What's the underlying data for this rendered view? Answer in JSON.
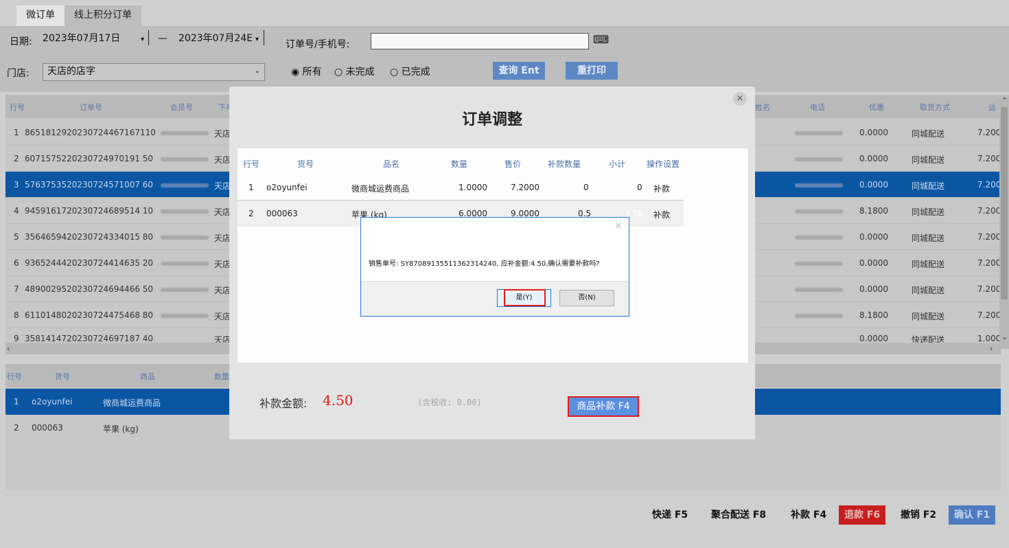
{
  "tabs": [
    "微订单",
    "线上积分订单"
  ],
  "filters": {
    "date_label": "日期:",
    "date_from": "2023年07月17日",
    "date_sep": "—",
    "date_to": "2023年07月24E",
    "order_label": "订单号/手机号:",
    "order_value": "",
    "store_label": "门店:",
    "store_value": "天店的店字",
    "radio_all": "◉ 所有",
    "radio_incomplete": "○ 未完成",
    "radio_complete": "○ 已完成",
    "query_button": "查询 Ent",
    "reprint_button": "重打印"
  },
  "orders_table": {
    "headers": [
      "行号",
      "订单号",
      "会员号",
      "下单",
      "姓名",
      "电话",
      "优惠",
      "取货方式",
      "运"
    ],
    "rows": [
      {
        "no": "1",
        "order": "8651812920230724467167110",
        "store": "天店",
        "discount": "0.0000",
        "delivery": "同城配送",
        "fee": "7.200"
      },
      {
        "no": "2",
        "order": "6071575220230724970191 50",
        "store": "天店",
        "discount": "0.0000",
        "delivery": "同城配送",
        "fee": "7.200"
      },
      {
        "no": "3",
        "order": "5763753520230724571007 60",
        "store": "天店",
        "discount": "0.0000",
        "delivery": "同城配送",
        "fee": "7.200"
      },
      {
        "no": "4",
        "order": "9459161720230724689514 10",
        "store": "天店",
        "discount": "8.1800",
        "delivery": "同城配送",
        "fee": "7.200"
      },
      {
        "no": "5",
        "order": "3564659420230724334015 80",
        "store": "天店",
        "discount": "0.0000",
        "delivery": "同城配送",
        "fee": "7.200"
      },
      {
        "no": "6",
        "order": "9365244420230724414635 20",
        "store": "天店",
        "discount": "0.0000",
        "delivery": "同城配送",
        "fee": "7.200"
      },
      {
        "no": "7",
        "order": "4890029520230724694466 50",
        "store": "天店",
        "discount": "0.0000",
        "delivery": "同城配送",
        "fee": "7.200"
      },
      {
        "no": "8",
        "order": "6110148020230724475468 80",
        "store": "天店",
        "discount": "8.1800",
        "delivery": "同城配送",
        "fee": "7.200"
      },
      {
        "no": "9",
        "order": "3581414720230724697187 40",
        "store": "天店",
        "discount": "0.0000",
        "delivery": "快递配送",
        "fee": "1.000"
      }
    ]
  },
  "items_table": {
    "headers": [
      "行号",
      "货号",
      "商品",
      "数量"
    ],
    "rows": [
      {
        "no": "1",
        "sku": "o2oyunfei",
        "name": "微商城运费商品"
      },
      {
        "no": "2",
        "sku": "000063",
        "name": "苹果 (kg)"
      }
    ]
  },
  "bottom_buttons": {
    "express": "快递 F5",
    "merge": "聚合配送 F8",
    "refund_pay": "补款 F4",
    "return": "退款 F6",
    "cancel": "撤销 F2",
    "confirm": "确认 F1"
  },
  "modal": {
    "title": "订单调整",
    "close": "×",
    "headers": [
      "行号",
      "货号",
      "品名",
      "数量",
      "售价",
      "补款数量",
      "小计",
      "操作设置"
    ],
    "rows": [
      {
        "no": "1",
        "sku": "o2oyunfei",
        "name": "微商城运费商品",
        "qty": "1.0000",
        "price": "7.2000",
        "supp_qty": "0",
        "subtotal": "0",
        "action": "补款"
      },
      {
        "no": "2",
        "sku": "000063",
        "name": "苹果 (kg)",
        "qty": "6.0000",
        "price": "9.0000",
        "supp_qty": "0.5",
        "subtotal": "4.50",
        "action": "补款"
      }
    ],
    "amount_label": "补款金额:",
    "amount_value": "4.50",
    "tax_note": "(含税收: 0.00)",
    "supplement_button": "商品补款 F4"
  },
  "dialog": {
    "message": "销售单号: SY87089135511362314240, 应补金额:4.50,确认需要补款吗?",
    "yes": "是(Y)",
    "no": "否(N)",
    "close": "×"
  },
  "colors": {
    "selected_row": "#0b56a3",
    "accent_red": "#e11b1b",
    "button_blue": "#5b8fe0",
    "dialog_border": "#2a78d1"
  }
}
